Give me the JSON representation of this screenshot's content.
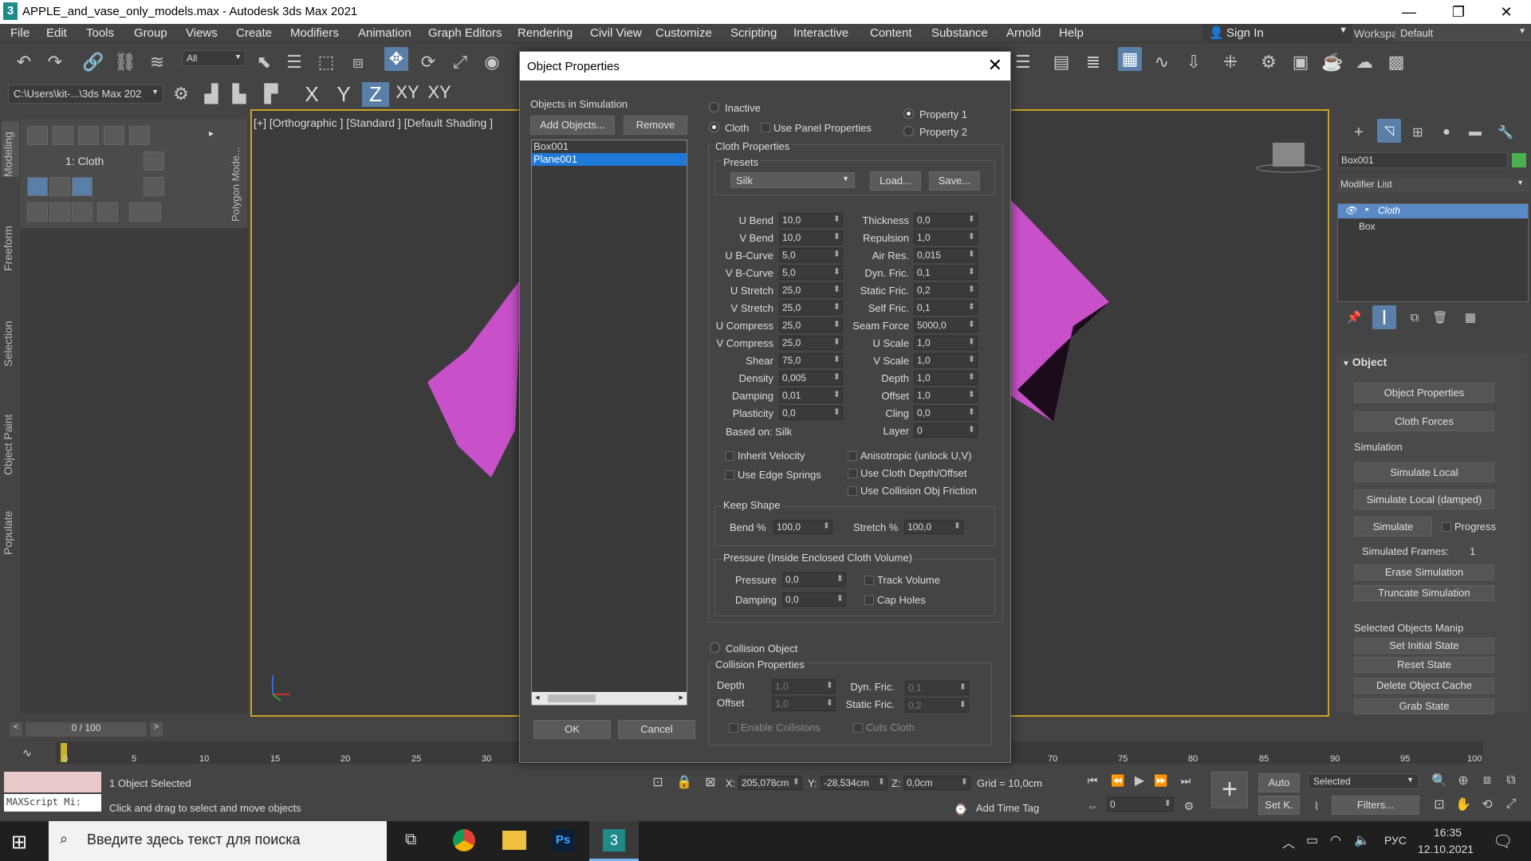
{
  "window": {
    "title": "APPLE_and_vase_only_models.max - Autodesk 3ds Max 2021",
    "app_icon": "3"
  },
  "menu": [
    "File",
    "Edit",
    "Tools",
    "Group",
    "Views",
    "Create",
    "Modifiers",
    "Animation",
    "Graph Editors",
    "Rendering",
    "Civil View",
    "Customize",
    "Scripting",
    "Interactive",
    "Content",
    "Substance",
    "Arnold",
    "Help"
  ],
  "account": {
    "sign_in": "Sign In",
    "workspaces_label": "Workspaces:",
    "workspace": "Default"
  },
  "toolbar": {
    "selection_filter": "All",
    "project_path": "C:\\Users\\kit-...\\3ds Max 202",
    "axes": [
      "X",
      "Y",
      "Z",
      "XY",
      "XY"
    ]
  },
  "left_tabs": [
    "Modeling",
    "Freeform",
    "Selection",
    "Object Paint",
    "Populate"
  ],
  "ribbon": {
    "modifier_label": "1: Cloth",
    "polygon_tab": "Polygon Mode..."
  },
  "viewport": {
    "label": "[+] [Orthographic ] [Standard ] [Default Shading ]"
  },
  "command_panel": {
    "object_name": "Box001",
    "object_color": "#4caf50",
    "modifier_list": "Modifier List",
    "stack": [
      "Cloth",
      "Box"
    ],
    "rollout": "Object",
    "buttons": [
      "Object Properties",
      "Cloth Forces"
    ],
    "simulation_label": "Simulation",
    "sim_buttons": [
      "Simulate Local",
      "Simulate Local (damped)"
    ],
    "simulate": "Simulate",
    "progress": "Progress",
    "simulated_frames_label": "Simulated Frames:",
    "simulated_frames": "1",
    "erase": "Erase Simulation",
    "truncate": "Truncate Simulation",
    "manip_label": "Selected Objects Manip",
    "manip_buttons": [
      "Set Initial State",
      "Reset State",
      "Delete Object Cache",
      "Grab State"
    ]
  },
  "dialog": {
    "title": "Object Properties",
    "objects_label": "Objects in Simulation",
    "add_objects": "Add Objects...",
    "remove": "Remove",
    "objects": [
      "Box001",
      "Plane001"
    ],
    "inactive": "Inactive",
    "cloth": "Cloth",
    "use_panel": "Use Panel Properties",
    "property1": "Property 1",
    "property2": "Property 2",
    "cloth_properties": "Cloth Properties",
    "presets": "Presets",
    "preset_value": "Silk",
    "load": "Load...",
    "save": "Save...",
    "left_params": [
      [
        "U Bend",
        "10,0"
      ],
      [
        "V Bend",
        "10,0"
      ],
      [
        "U B-Curve",
        "5,0"
      ],
      [
        "V B-Curve",
        "5,0"
      ],
      [
        "U Stretch",
        "25,0"
      ],
      [
        "V Stretch",
        "25,0"
      ],
      [
        "U Compress",
        "25,0"
      ],
      [
        "V Compress",
        "25,0"
      ],
      [
        "Shear",
        "75,0"
      ],
      [
        "Density",
        "0,005"
      ],
      [
        "Damping",
        "0,01"
      ],
      [
        "Plasticity",
        "0,0"
      ]
    ],
    "right_params": [
      [
        "Thickness",
        "0,0"
      ],
      [
        "Repulsion",
        "1,0"
      ],
      [
        "Air Res.",
        "0,015"
      ],
      [
        "Dyn. Fric.",
        "0,1"
      ],
      [
        "Static Fric.",
        "0,2"
      ],
      [
        "Self Fric.",
        "0,1"
      ],
      [
        "Seam Force",
        "5000,0"
      ],
      [
        "U Scale",
        "1,0"
      ],
      [
        "V Scale",
        "1,0"
      ],
      [
        "Depth",
        "1,0"
      ],
      [
        "Offset",
        "1,0"
      ],
      [
        "Cling",
        "0,0"
      ],
      [
        "Layer",
        "0"
      ]
    ],
    "based_on": "Based on: Silk",
    "inherit_velocity": "Inherit Velocity",
    "use_edge_springs": "Use Edge Springs",
    "anisotropic": "Anisotropic (unlock U,V)",
    "use_cloth_depth": "Use Cloth Depth/Offset",
    "use_collision_friction": "Use Collision Obj Friction",
    "keep_shape": "Keep Shape",
    "bend_pct_label": "Bend %",
    "bend_pct": "100,0",
    "stretch_pct_label": "Stretch %",
    "stretch_pct": "100,0",
    "pressure_group": "Pressure (Inside Enclosed Cloth Volume)",
    "pressure_label": "Pressure",
    "pressure": "0,0",
    "damping_label": "Damping",
    "damping": "0,0",
    "track_volume": "Track Volume",
    "cap_holes": "Cap Holes",
    "collision_object": "Collision Object",
    "collision_properties": "Collision Properties",
    "c_depth_label": "Depth",
    "c_depth": "1,0",
    "c_offset_label": "Offset",
    "c_offset": "1,0",
    "c_dyn_label": "Dyn. Fric.",
    "c_dyn": "0,1",
    "c_static_label": "Static Fric.",
    "c_static": "0,2",
    "enable_collisions": "Enable Collisions",
    "cuts_cloth": "Cuts Cloth",
    "ok": "OK",
    "cancel": "Cancel"
  },
  "timeline": {
    "frame": "0 / 100",
    "ticks": [
      "0",
      "5",
      "10",
      "15",
      "20",
      "25",
      "30",
      "70",
      "75",
      "80",
      "85",
      "90",
      "95",
      "100"
    ]
  },
  "status": {
    "maxscript": "MAXScript Mi:",
    "selected": "1 Object Selected",
    "hint": "Click and drag to select and move objects",
    "x_label": "X:",
    "x": "205,078cm",
    "y_label": "Y:",
    "y": "-28,534cm",
    "z_label": "Z:",
    "z": "0,0cm",
    "grid": "Grid = 10,0cm",
    "add_time_tag": "Add Time Tag",
    "auto": "Auto",
    "set_key": "Set K.",
    "key_mode": "Selected",
    "filters": "Filters...",
    "frame_field": "0"
  },
  "taskbar": {
    "search": "Введите здесь текст для поиска",
    "lang": "РУС",
    "time": "16:35",
    "date": "12.10.2021"
  }
}
